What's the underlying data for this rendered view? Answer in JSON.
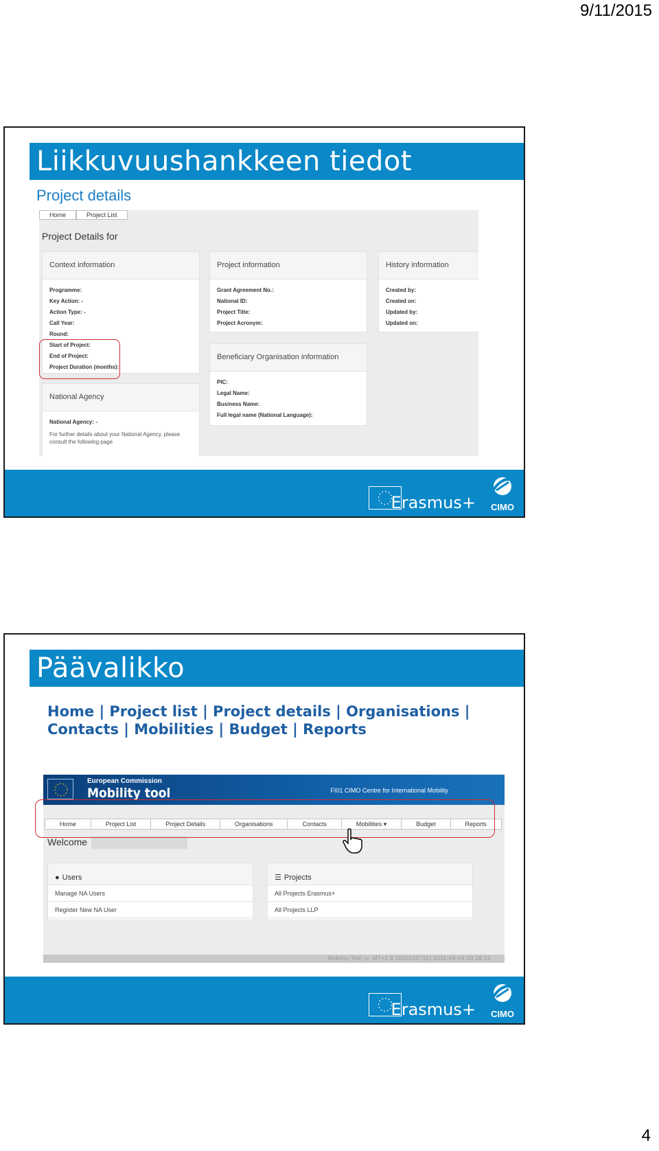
{
  "page": {
    "date": "9/11/2015",
    "number": "4"
  },
  "slide1": {
    "title": "Liikkuvuushankkeen tiedot",
    "subtitle": "Project details",
    "screenshot": {
      "nav_tabs": [
        "Home",
        "Project List"
      ],
      "heading": "Project Details for",
      "context": {
        "title": "Context information",
        "fields": [
          "Programme:",
          "Key Action: -",
          "Action Type: -",
          "Call Year:",
          "Round:",
          "Start of Project:",
          "End of Project:",
          "Project Duration (months):"
        ]
      },
      "project": {
        "title": "Project information",
        "fields": [
          "Grant Agreement No.:",
          "National ID:",
          "Project Title:",
          "Project Acronym:"
        ]
      },
      "history": {
        "title": "History information",
        "fields": [
          "Created by:",
          "Created on:",
          "Updated by:",
          "Updated on:"
        ]
      },
      "beneficiary": {
        "title": "Beneficiary Organisation information",
        "fields": [
          "PIC:",
          "Legal Name:",
          "Business Name:",
          "Full legal name (National Language):"
        ]
      },
      "agency": {
        "title": "National Agency",
        "field": "National Agency: -",
        "note": "For further details about your National Agency, please consult the following page"
      }
    }
  },
  "slide2": {
    "title": "Päävalikko",
    "menu_line1": "Home | Project list | Project details | Organisations |",
    "menu_line2": "Contacts | Mobilities | Budget | Reports",
    "screenshot": {
      "ec_label": "European Commission",
      "app_title": "Mobility tool",
      "org": "FI01 CIMO Centre for International Mobility",
      "nav": [
        "Home",
        "Project List",
        "Project Details",
        "Organisations",
        "Contacts",
        "Mobilities ▾",
        "Budget",
        "Reports"
      ],
      "welcome": "Welcome",
      "users_panel": {
        "title": "Users",
        "rows": [
          "Manage NA Users",
          "Register New NA User"
        ]
      },
      "projects_panel": {
        "title": "Projects",
        "rows": [
          "All Projects Erasmus+",
          "All Projects LLP"
        ]
      },
      "status": "Mobility Tool (v. MT+1.9.1#20150731) 2015-09-04 09:28:12"
    }
  },
  "footer": {
    "erasmus": "Erasmus+",
    "cimo": "CIMO"
  },
  "colors": {
    "accent_blue": "#0a88c8",
    "menu_blue": "#1f5fa3",
    "highlight_red": "#d12a2a"
  },
  "icons": [
    "eu-flag-icon",
    "cimo-logo-icon",
    "user-icon",
    "list-icon",
    "hand-cursor-icon"
  ]
}
